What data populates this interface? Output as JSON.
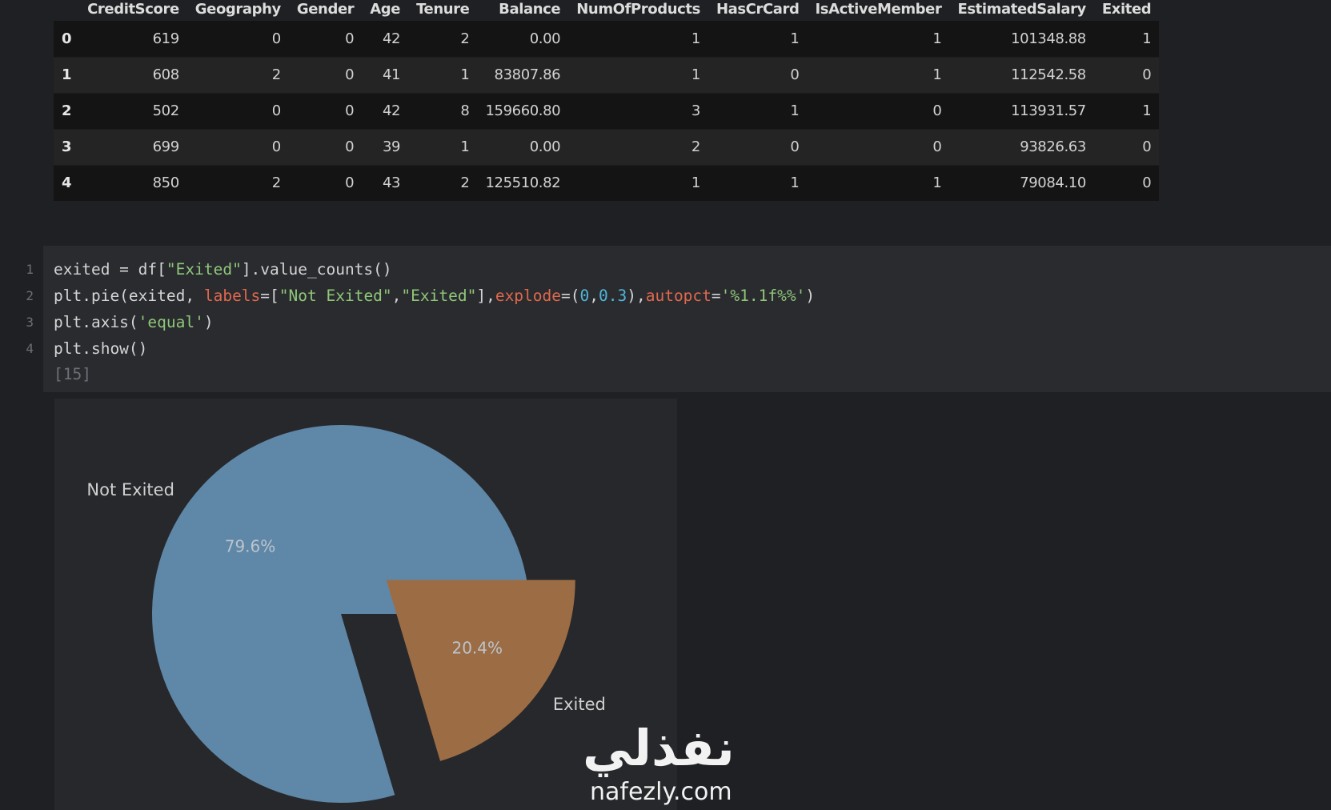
{
  "dataframe": {
    "columns": [
      "",
      "CreditScore",
      "Geography",
      "Gender",
      "Age",
      "Tenure",
      "Balance",
      "NumOfProducts",
      "HasCrCard",
      "IsActiveMember",
      "EstimatedSalary",
      "Exited"
    ],
    "rows": [
      [
        "0",
        "619",
        "0",
        "0",
        "42",
        "2",
        "0.00",
        "1",
        "1",
        "1",
        "101348.88",
        "1"
      ],
      [
        "1",
        "608",
        "2",
        "0",
        "41",
        "1",
        "83807.86",
        "1",
        "0",
        "1",
        "112542.58",
        "0"
      ],
      [
        "2",
        "502",
        "0",
        "0",
        "42",
        "8",
        "159660.80",
        "3",
        "1",
        "0",
        "113931.57",
        "1"
      ],
      [
        "3",
        "699",
        "0",
        "0",
        "39",
        "1",
        "0.00",
        "2",
        "0",
        "0",
        "93826.63",
        "0"
      ],
      [
        "4",
        "850",
        "2",
        "0",
        "43",
        "2",
        "125510.82",
        "1",
        "1",
        "1",
        "79084.10",
        "0"
      ]
    ]
  },
  "code_cell": {
    "line_numbers": [
      "1",
      "2",
      "3",
      "4"
    ],
    "lines": [
      [
        {
          "t": "exited = df[",
          "c": ""
        },
        {
          "t": "\"Exited\"",
          "c": "str"
        },
        {
          "t": "].value_counts()",
          "c": ""
        }
      ],
      [
        {
          "t": "plt.pie(exited, ",
          "c": ""
        },
        {
          "t": "labels",
          "c": "kw"
        },
        {
          "t": "=[",
          "c": ""
        },
        {
          "t": "\"Not Exited\"",
          "c": "str"
        },
        {
          "t": ",",
          "c": ""
        },
        {
          "t": "\"Exited\"",
          "c": "str"
        },
        {
          "t": "],",
          "c": ""
        },
        {
          "t": "explode",
          "c": "kw"
        },
        {
          "t": "=(",
          "c": ""
        },
        {
          "t": "0",
          "c": "num"
        },
        {
          "t": ",",
          "c": ""
        },
        {
          "t": "0.3",
          "c": "num"
        },
        {
          "t": "),",
          "c": ""
        },
        {
          "t": "autopct",
          "c": "kw"
        },
        {
          "t": "=",
          "c": ""
        },
        {
          "t": "'%1.1f%%'",
          "c": "str"
        },
        {
          "t": ")",
          "c": ""
        }
      ],
      [
        {
          "t": "plt.axis(",
          "c": ""
        },
        {
          "t": "'equal'",
          "c": "str"
        },
        {
          "t": ")",
          "c": ""
        }
      ],
      [
        {
          "t": "plt.show()",
          "c": ""
        }
      ]
    ],
    "execution_count": "[15]"
  },
  "chart_data": {
    "type": "pie",
    "labels": [
      "Not Exited",
      "Exited"
    ],
    "values": [
      79.6,
      20.4
    ],
    "pct_labels": [
      "79.6%",
      "20.4%"
    ],
    "explode": [
      0,
      0.3
    ],
    "colors": [
      "#5f87a7",
      "#9c6d45"
    ],
    "start_angle_deg": 0
  },
  "watermark": {
    "arabic": "نفذلي",
    "latin": "nafezly.com"
  },
  "theme": {
    "background": "#1f2023",
    "code_cell_bg": "#2a2b2f",
    "plot_bg": "#27282b"
  }
}
